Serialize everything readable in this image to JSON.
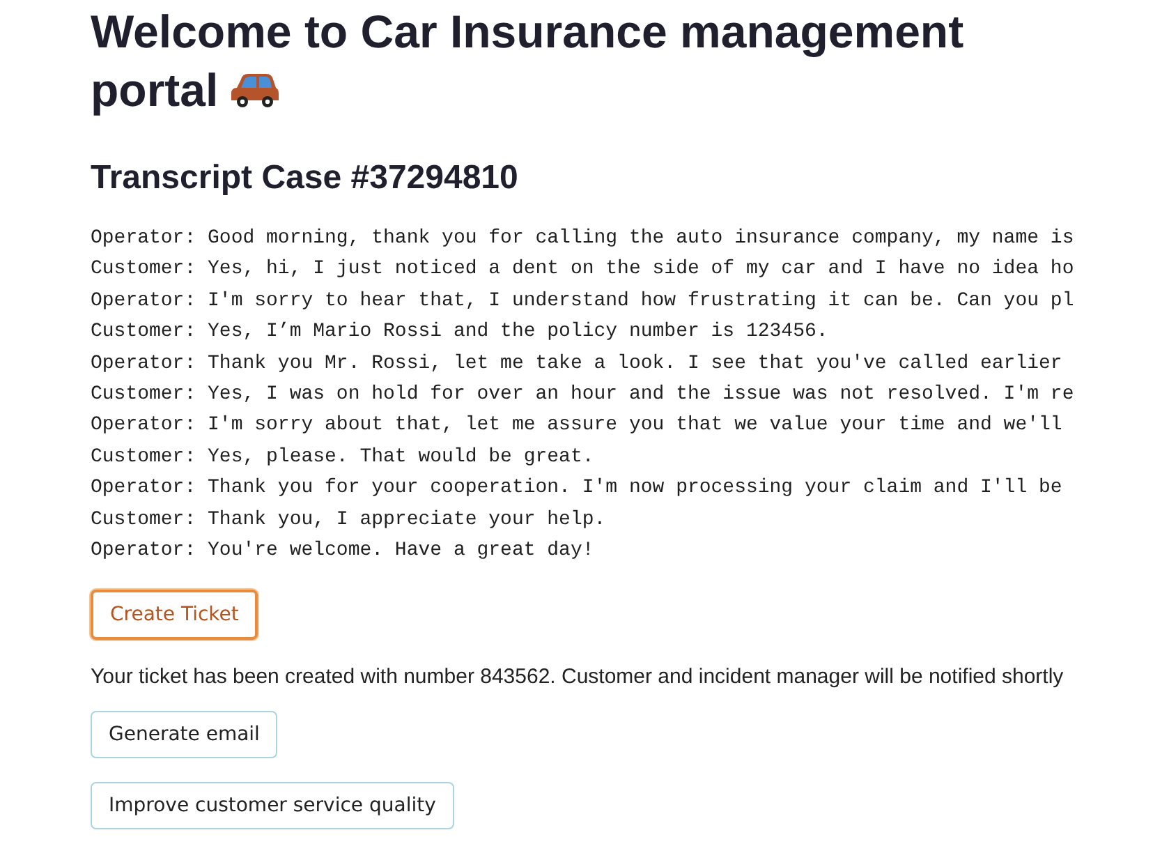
{
  "title_lines": [
    "Welcome to Car Insurance management",
    "portal"
  ],
  "transcript": {
    "heading": "Transcript Case #37294810",
    "lines": [
      "Operator: Good morning, thank you for calling the auto insurance company, my name is",
      "Customer: Yes, hi, I just noticed a dent on the side of my car and I have no idea ho",
      "Operator: I'm sorry to hear that, I understand how frustrating it can be. Can you pl",
      "Customer: Yes, I’m Mario Rossi and the policy number is 123456.",
      "Operator: Thank you Mr. Rossi, let me take a look. I see that you've called earlier",
      "Customer: Yes, I was on hold for over an hour and the issue was not resolved. I'm re",
      "Operator: I'm sorry about that, let me assure you that we value your time and we'll",
      "Customer: Yes, please. That would be great.",
      "Operator: Thank you for your cooperation. I'm now processing your claim and I'll be",
      "Customer: Thank you, I appreciate your help.",
      "Operator: You're welcome. Have a great day!"
    ]
  },
  "content": [
    {
      "kind": "button",
      "label": "Create Ticket",
      "focused": true
    },
    {
      "kind": "message",
      "text": "Your ticket has been created with number 843562. Customer and incident manager will be notified shortly"
    },
    {
      "kind": "button",
      "label": "Generate email",
      "focused": false
    },
    {
      "kind": "button",
      "label": "Improve customer service quality",
      "focused": false
    }
  ]
}
